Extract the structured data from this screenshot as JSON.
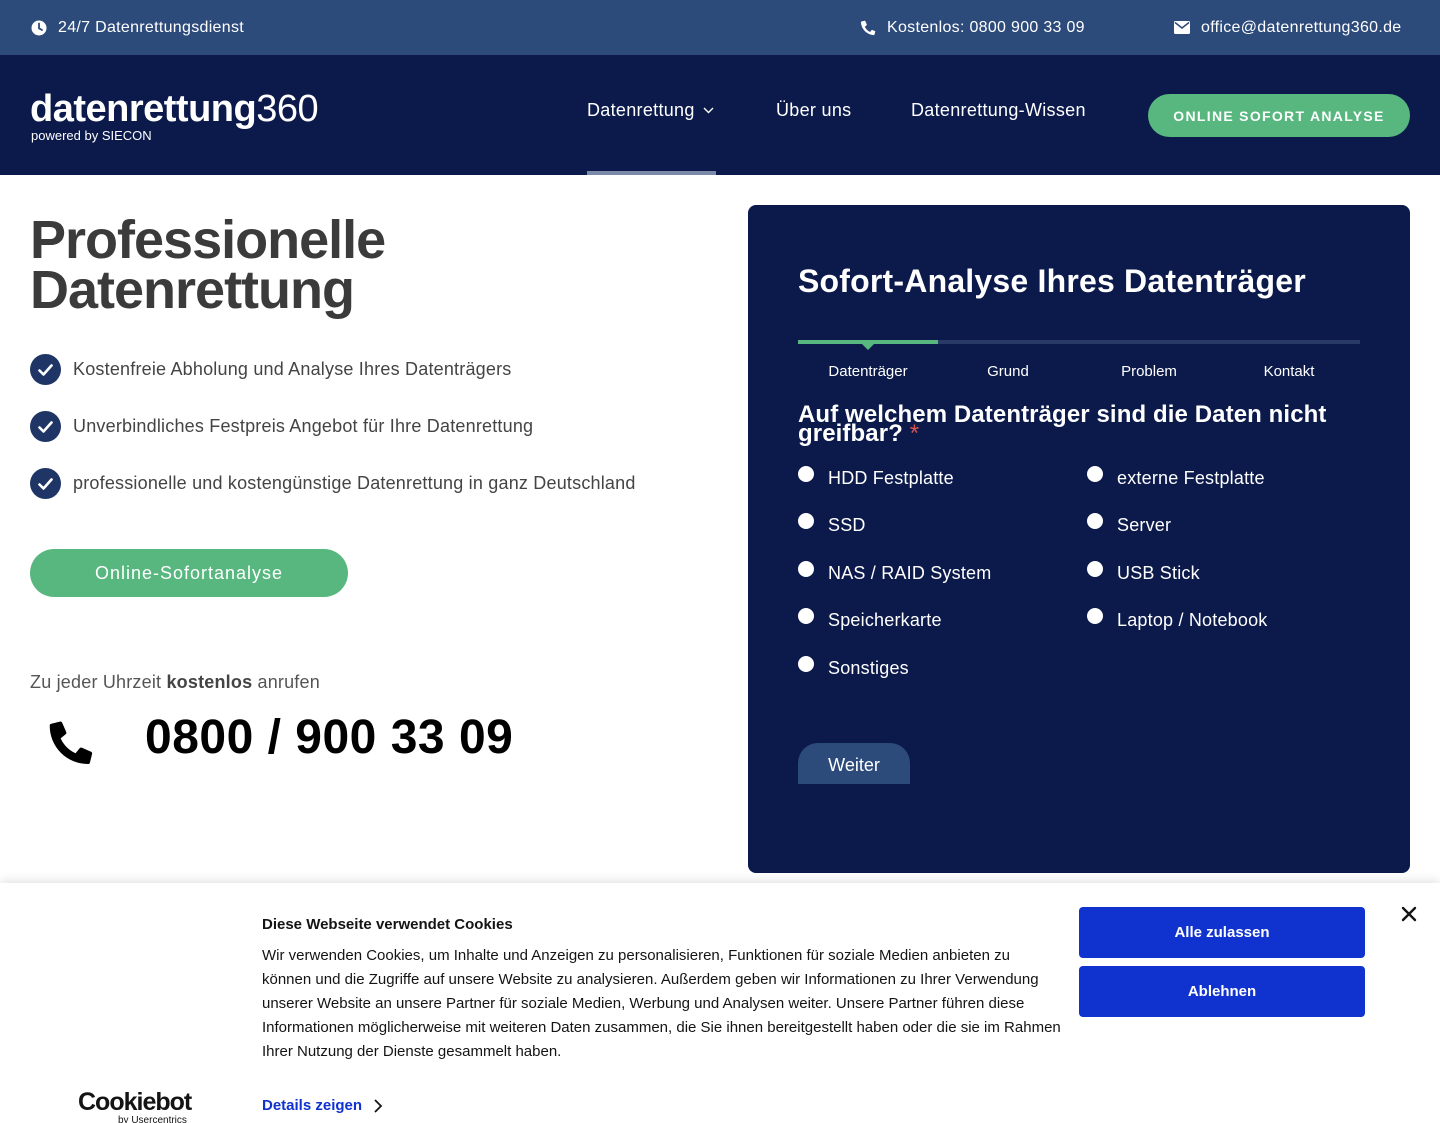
{
  "topbar": {
    "service": "24/7 Datenrettungsdienst",
    "phone": "Kostenlos: 0800 900 33 09",
    "email": "office@datenrettung360.de"
  },
  "header": {
    "logo_main": "datenrettung",
    "logo_num": "360",
    "logo_sub": "powered by SIECON",
    "nav": [
      "Datenrettung",
      "Über uns",
      "Datenrettung-Wissen"
    ],
    "cta": "ONLINE SOFORT ANALYSE"
  },
  "hero": {
    "title_line1": "Professionelle",
    "title_line2": "Datenrettung",
    "features": [
      "Kostenfreie Abholung und Analyse Ihres Datenträgers",
      "Unverbindliches Festpreis Angebot für Ihre Datenrettung",
      "professionelle und kostengünstige Datenrettung in ganz Deutschland"
    ],
    "button": "Online-Sofortanalyse",
    "call_pre": "Zu jeder Uhrzeit",
    "call_bold": "kostenlos",
    "call_post": "anrufen",
    "phone": "0800 / 900 33 09"
  },
  "form": {
    "title": "Sofort-Analyse Ihres Datenträger",
    "steps": [
      "Datenträger",
      "Grund",
      "Problem",
      "Kontakt"
    ],
    "active_step": 1,
    "question": "Auf welchem Datenträger sind die Daten nicht greifbar?",
    "required_mark": "*",
    "options_left": [
      "HDD Festplatte",
      "SSD",
      "NAS / RAID System",
      "Speicherkarte",
      "Sonstiges"
    ],
    "options_right": [
      "externe Festplatte",
      "Server",
      "USB Stick",
      "Laptop / Notebook"
    ],
    "next": "Weiter"
  },
  "cookie": {
    "title": "Diese Webseite verwendet Cookies",
    "text": "Wir verwenden Cookies, um Inhalte und Anzeigen zu personalisieren, Funktionen für soziale Medien anbieten zu können und die Zugriffe auf unsere Website zu analysieren. Außerdem geben wir Informationen zu Ihrer Verwendung unserer Website an unsere Partner für soziale Medien, Werbung und Analysen weiter. Unsere Partner führen diese Informationen möglicherweise mit weiteren Daten zusammen, die Sie ihnen bereitgestellt haben oder die sie im Rahmen Ihrer Nutzung der Dienste gesammelt haben.",
    "details": "Details zeigen",
    "allow": "Alle zulassen",
    "deny": "Ablehnen",
    "brand": "Cookiebot",
    "brand_sub": "by Usercentrics"
  },
  "colors": {
    "topbar": "#2c4a7a",
    "header": "#0b1a4b",
    "accent_green": "#57b77f",
    "cookie_blue": "#1032cf"
  }
}
